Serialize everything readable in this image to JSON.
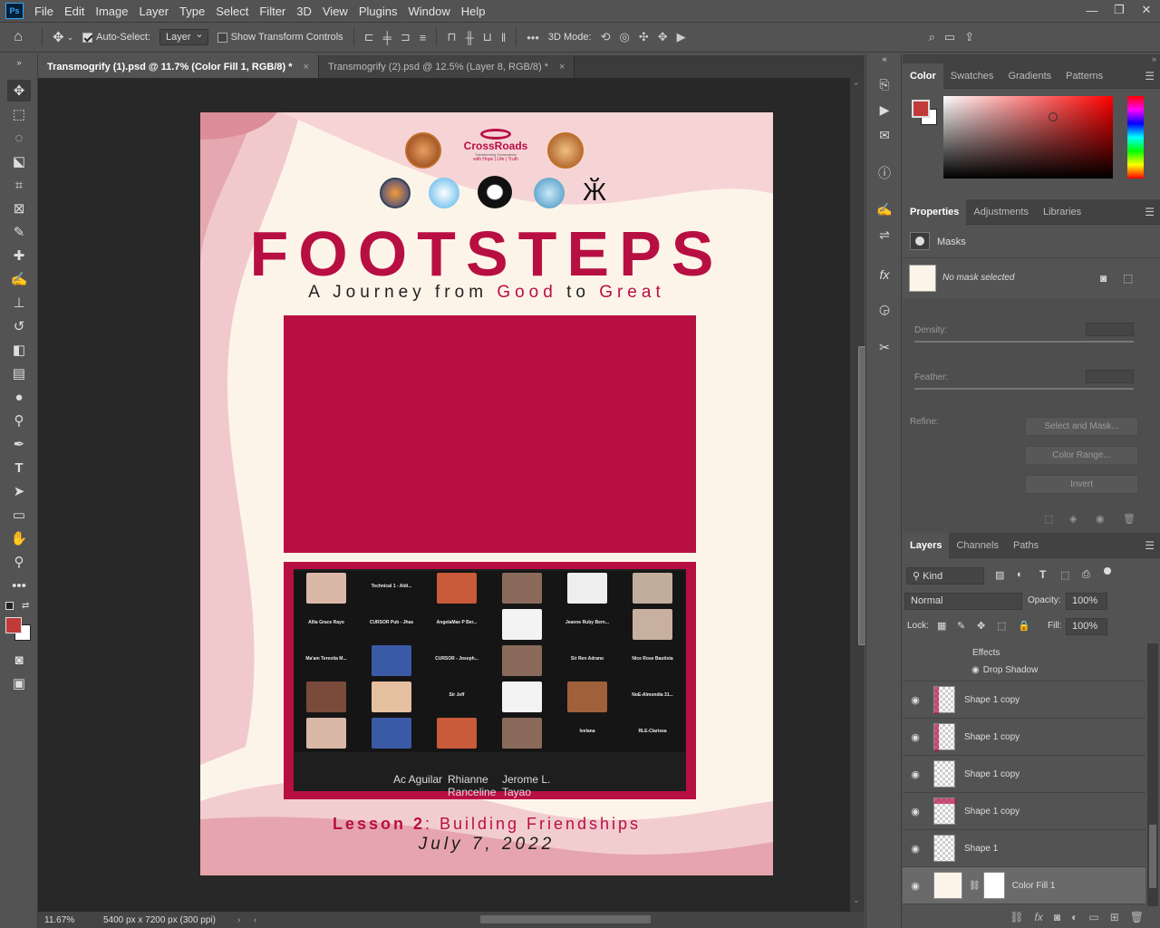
{
  "app": {
    "logo_text": "Ps"
  },
  "menu": [
    "File",
    "Edit",
    "Image",
    "Layer",
    "Type",
    "Select",
    "Filter",
    "3D",
    "View",
    "Plugins",
    "Window",
    "Help"
  ],
  "window_controls": {
    "minimize": "—",
    "restore": "❐",
    "close": "✕"
  },
  "options": {
    "auto_select_label": "Auto-Select:",
    "auto_select_value": "Layer",
    "show_transform_label": "Show Transform Controls",
    "mode_3d_label": "3D Mode:"
  },
  "tabs": [
    {
      "label": "Transmogrify (1).psd @ 11.7% (Color Fill 1, RGB/8) *",
      "close": "×"
    },
    {
      "label": "Transmogrify (2).psd @ 12.5% (Layer 8, RGB/8) *",
      "close": "×"
    }
  ],
  "status": {
    "zoom": "11.67%",
    "doc_info": "5400 px x 7200 px (300 ppi)"
  },
  "document": {
    "crossroads_name": "CrossRoads",
    "crossroads_tag1": "Transforming Generations",
    "crossroads_tag2": "with Hope | Life | Truth",
    "title": "FOOTSTEPS",
    "subtitle_a": "A Journey from ",
    "subtitle_b": "Good",
    "subtitle_c": " to ",
    "subtitle_d": "Great",
    "lesson_a": "Lesson 2",
    "lesson_b": ": Building Friendships",
    "date": "July 7, 2022",
    "zoom_names": [
      "Technical 1 - Aldi...",
      "Allia Grace Rayo",
      "CURSOR Pub - Jhas",
      "AngelaMae P Ber...",
      "Jeanne Ruby Bern...",
      "Ma'am Teresita M...",
      "CURSOR - Joseph...",
      "Sir Ren Adrano",
      "Nice Rose Bautista",
      "Sir Jeff",
      "NoE-Almondia 31...",
      "Ivelana",
      "RLE-Clarissa",
      "Rhianne Ranceline",
      "Jerome L. Tayao",
      "Ac Aguilar"
    ]
  },
  "panels": {
    "color_tabs": [
      "Color",
      "Swatches",
      "Gradients",
      "Patterns"
    ],
    "colors": {
      "foreground": "#c13a3a",
      "background": "#ffffff",
      "accent": "#b80f43",
      "cream": "#fdf4e9"
    },
    "props_tabs": [
      "Properties",
      "Adjustments",
      "Libraries"
    ],
    "masks_label": "Masks",
    "no_mask": "No mask selected",
    "density_label": "Density:",
    "feather_label": "Feather:",
    "refine_label": "Refine:",
    "select_mask_btn": "Select and Mask...",
    "color_range_btn": "Color Range...",
    "invert_btn": "Invert",
    "layers_tabs": [
      "Layers",
      "Channels",
      "Paths"
    ],
    "kind_label": "Kind",
    "blend_mode": "Normal",
    "opacity_label": "Opacity:",
    "opacity_value": "100%",
    "lock_label": "Lock:",
    "fill_label": "Fill:",
    "fill_value": "100%",
    "effects_label": "Effects",
    "drop_shadow_label": "Drop Shadow",
    "layers": [
      "Shape 1 copy",
      "Shape 1 copy",
      "Shape 1 copy",
      "Shape 1 copy",
      "Shape 1",
      "Color Fill 1"
    ]
  }
}
